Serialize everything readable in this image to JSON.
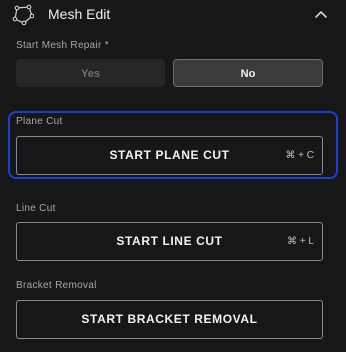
{
  "header": {
    "title": "Mesh Edit",
    "icon": "mesh-polygon-icon",
    "chevron": "chevron-up-icon"
  },
  "start_mesh_repair": {
    "label": "Start Mesh Repair *",
    "options": [
      "Yes",
      "No"
    ],
    "selected": "No"
  },
  "plane_cut": {
    "label": "Plane Cut",
    "button": "START PLANE CUT",
    "shortcut": "⌘ + C"
  },
  "line_cut": {
    "label": "Line Cut",
    "button": "START LINE CUT",
    "shortcut": "⌘ + L"
  },
  "bracket_removal": {
    "label": "Bracket Removal",
    "button": "START BRACKET REMOVAL"
  },
  "colors": {
    "background": "#171717",
    "focus_ring": "#1d3fd8",
    "selected_segment": "#3b3b3b"
  }
}
